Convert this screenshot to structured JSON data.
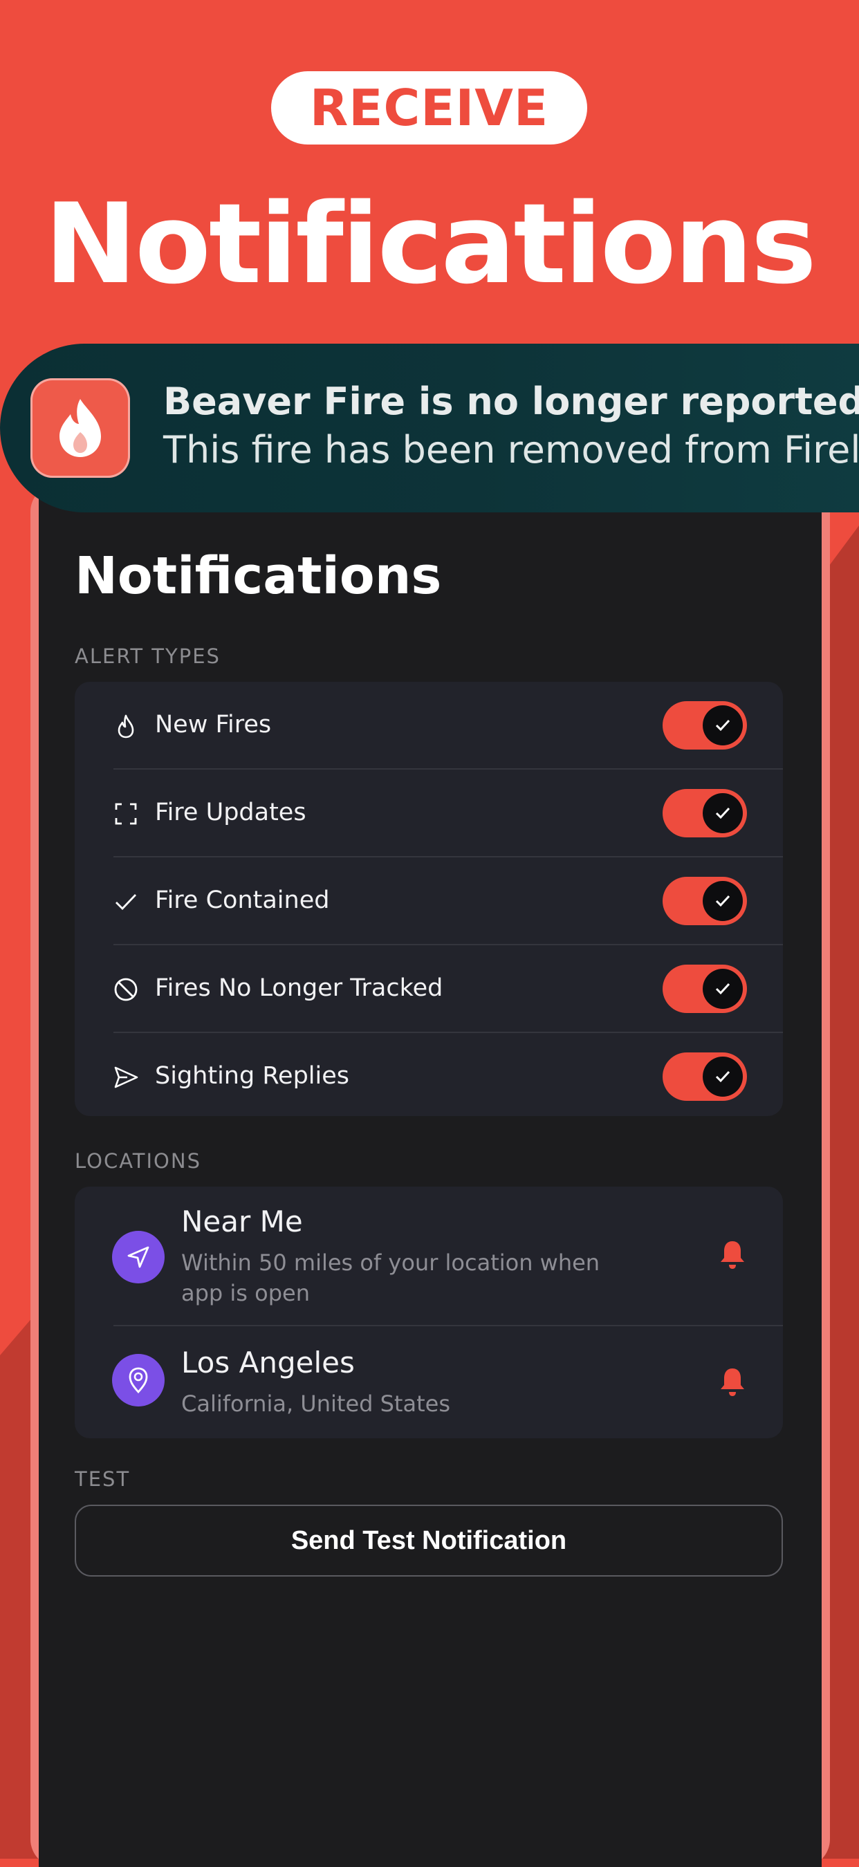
{
  "promo": {
    "badge": "RECEIVE",
    "headline": "Notifications"
  },
  "notification_banner": {
    "icon": "flame-app-icon",
    "title": "Beaver Fire is no longer reported...",
    "body": "This fire has been removed from Firelo"
  },
  "screen": {
    "title": "Notifications",
    "sections": {
      "alert_types": "ALERT TYPES",
      "locations": "LOCATIONS",
      "test": "TEST"
    },
    "alert_types": [
      {
        "label": "New Fires",
        "icon": "flame-icon",
        "enabled": true
      },
      {
        "label": "Fire Updates",
        "icon": "focus-frame-icon",
        "enabled": true
      },
      {
        "label": "Fire Contained",
        "icon": "check-icon",
        "enabled": true
      },
      {
        "label": "Fires No Longer Tracked",
        "icon": "prohibited-icon",
        "enabled": true
      },
      {
        "label": "Sighting Replies",
        "icon": "send-icon",
        "enabled": true
      }
    ],
    "locations": [
      {
        "name": "Near Me",
        "subtitle": "Within 50 miles of your location when app is open",
        "icon": "navigation-arrow-icon",
        "alerts": "bell-icon"
      },
      {
        "name": "Los Angeles",
        "subtitle": "California, United States",
        "icon": "map-pin-icon",
        "alerts": "bell-icon"
      }
    ],
    "test_button": "Send Test Notification"
  },
  "colors": {
    "brand": "#ee4c3e",
    "background_dark": "#1c1c1e",
    "card": "#22232b",
    "location_avatar": "#7b4fe6"
  }
}
